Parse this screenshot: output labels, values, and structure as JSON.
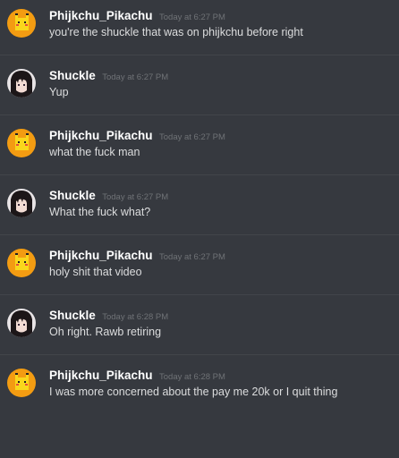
{
  "messages": [
    {
      "author": "Phijkchu_Pikachu",
      "timestamp": "Today at 6:27 PM",
      "text": "you're the shuckle that was on phijkchu before right",
      "avatar": "pikachu-avatar"
    },
    {
      "author": "Shuckle",
      "timestamp": "Today at 6:27 PM",
      "text": "Yup",
      "avatar": "anime-girl-avatar"
    },
    {
      "author": "Phijkchu_Pikachu",
      "timestamp": "Today at 6:27 PM",
      "text": "what the fuck man",
      "avatar": "pikachu-avatar"
    },
    {
      "author": "Shuckle",
      "timestamp": "Today at 6:27 PM",
      "text": "What the fuck what?",
      "avatar": "anime-girl-avatar"
    },
    {
      "author": "Phijkchu_Pikachu",
      "timestamp": "Today at 6:27 PM",
      "text": "holy shit that video",
      "avatar": "pikachu-avatar"
    },
    {
      "author": "Shuckle",
      "timestamp": "Today at 6:28 PM",
      "text": "Oh right. Rawb retiring",
      "avatar": "anime-girl-avatar"
    },
    {
      "author": "Phijkchu_Pikachu",
      "timestamp": "Today at 6:28 PM",
      "text": "I was more concerned about the pay me 20k or I quit thing",
      "avatar": "pikachu-avatar"
    }
  ],
  "colors": {
    "background": "#36393f",
    "username": "#ffffff",
    "timestamp": "#6f7276",
    "message_text": "#dcddde",
    "divider": "#42454a",
    "pikachu_yellow": "#f5c518",
    "pikachu_bg": "#f39c12"
  }
}
